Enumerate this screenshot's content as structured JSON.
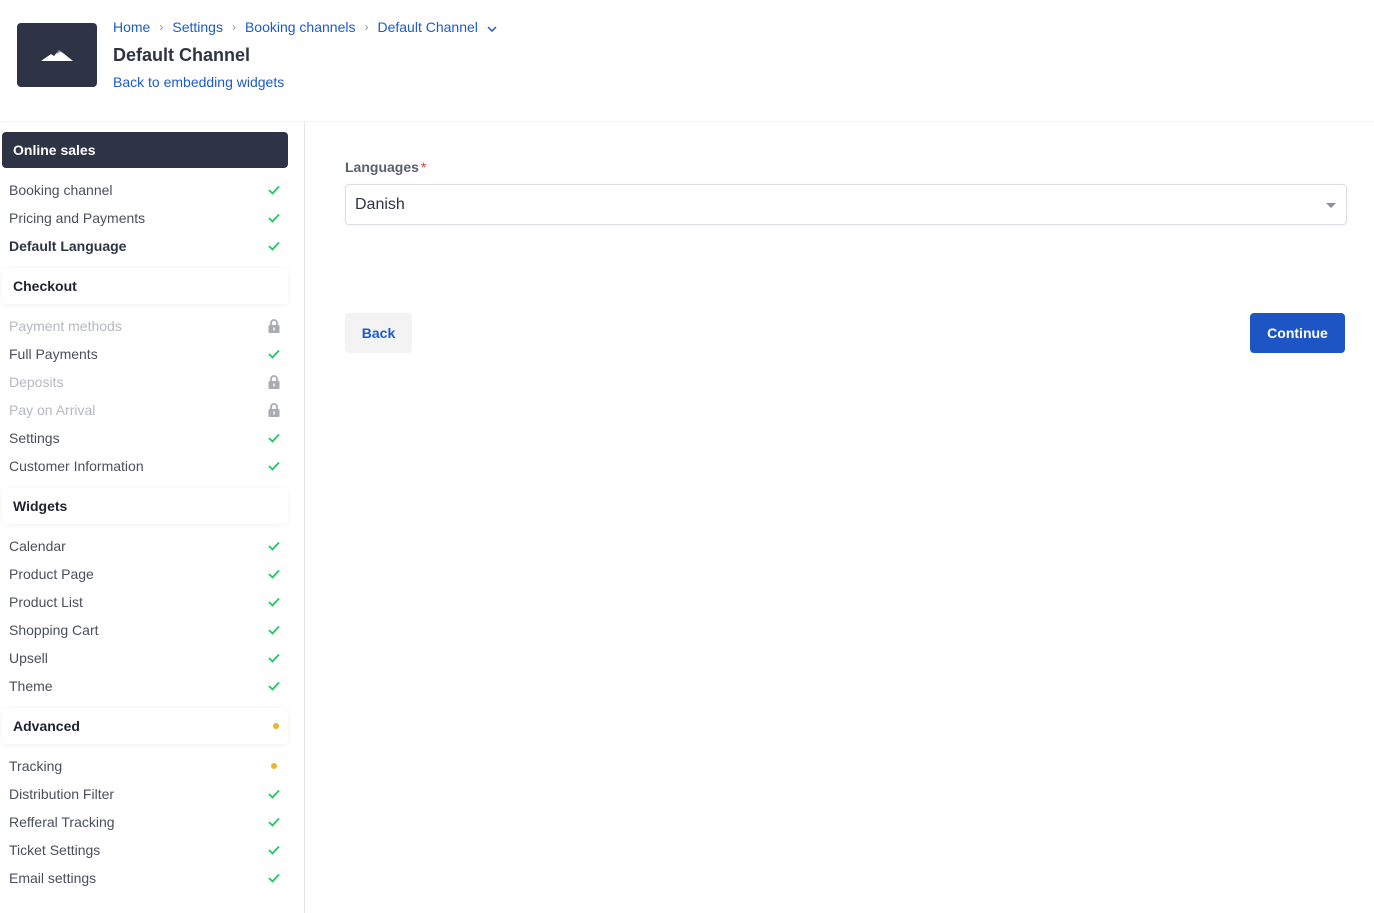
{
  "header": {
    "logo_icon": "mountain-icon",
    "breadcrumb": [
      {
        "label": "Home"
      },
      {
        "label": "Settings"
      },
      {
        "label": "Booking channels"
      },
      {
        "label": "Default Channel",
        "has_dropdown": true
      }
    ],
    "title": "Default Channel",
    "back_link": "Back to embedding widgets"
  },
  "sidebar": {
    "groups": [
      {
        "label": "Online sales",
        "active": true,
        "items": [
          {
            "label": "Booking channel",
            "status": "check"
          },
          {
            "label": "Pricing and Payments",
            "status": "check"
          },
          {
            "label": "Default Language",
            "status": "check",
            "current": true
          }
        ]
      },
      {
        "label": "Checkout",
        "items": [
          {
            "label": "Payment methods",
            "status": "lock"
          },
          {
            "label": "Full Payments",
            "status": "check"
          },
          {
            "label": "Deposits",
            "status": "lock"
          },
          {
            "label": "Pay on Arrival",
            "status": "lock"
          },
          {
            "label": "Settings",
            "status": "check"
          },
          {
            "label": "Customer Information",
            "status": "check"
          }
        ]
      },
      {
        "label": "Widgets",
        "items": [
          {
            "label": "Calendar",
            "status": "check"
          },
          {
            "label": "Product Page",
            "status": "check"
          },
          {
            "label": "Product List",
            "status": "check"
          },
          {
            "label": "Shopping Cart",
            "status": "check"
          },
          {
            "label": "Upsell",
            "status": "check"
          },
          {
            "label": "Theme",
            "status": "check"
          }
        ]
      },
      {
        "label": "Advanced",
        "status": "pending",
        "items": [
          {
            "label": "Tracking",
            "status": "pending"
          },
          {
            "label": "Distribution Filter",
            "status": "check"
          },
          {
            "label": "Refferal Tracking",
            "status": "check"
          },
          {
            "label": "Ticket Settings",
            "status": "check"
          },
          {
            "label": "Email settings",
            "status": "check"
          }
        ]
      }
    ]
  },
  "main": {
    "languages_label": "Languages",
    "required_mark": "*",
    "languages_value": "Danish",
    "back_button": "Back",
    "continue_button": "Continue"
  },
  "colors": {
    "accent": "#1d55c4",
    "link": "#1d5bc7",
    "dark": "#2e3445",
    "check": "#22c55e",
    "pending": "#f0b429",
    "lock": "#a9acb2"
  }
}
